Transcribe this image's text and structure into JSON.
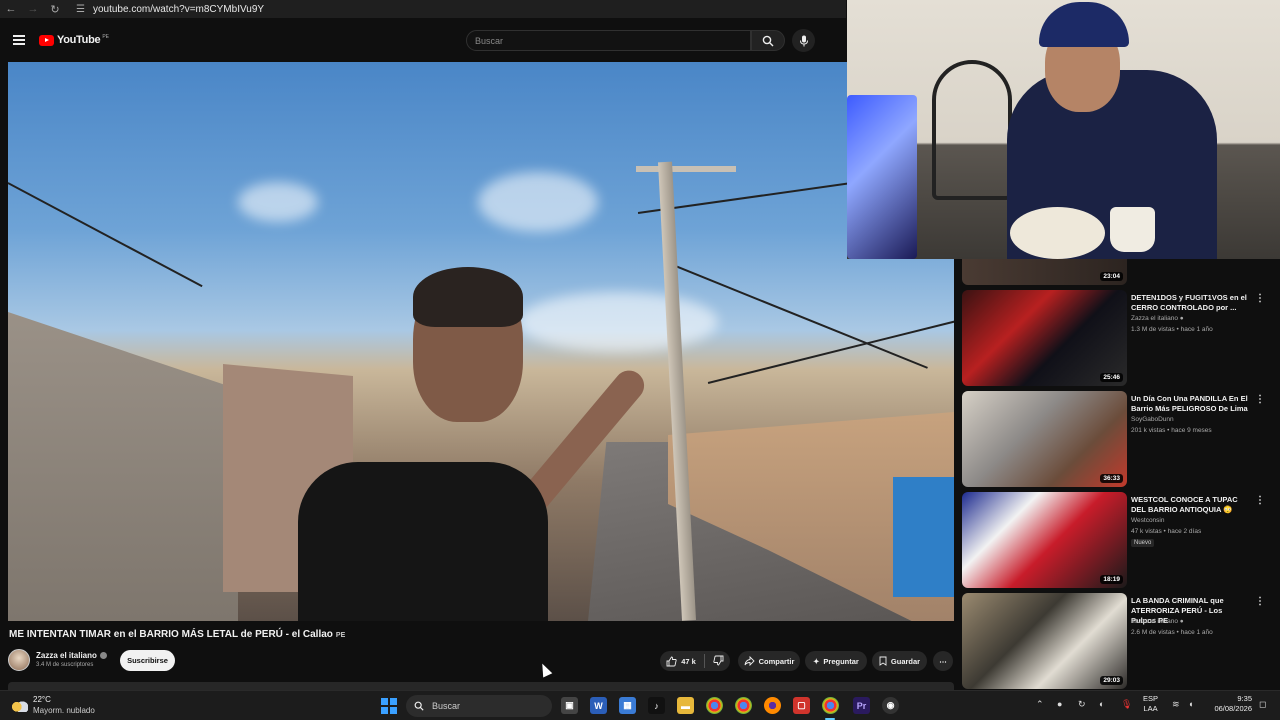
{
  "browser": {
    "url": "youtube.com/watch?v=m8CYMbIVu9Y",
    "icons": [
      "back-arrow-icon",
      "forward-arrow-icon",
      "reload-icon",
      "site-info-icon"
    ]
  },
  "header": {
    "logo_text": "YouTube",
    "country_code": "PE",
    "search_placeholder": "Buscar",
    "icons": [
      "hamburger-menu-icon",
      "search-icon",
      "microphone-icon"
    ]
  },
  "video": {
    "title": "ME INTENTAN TIMAR en el BARRIO MÁS LETAL de PERÚ - el Callao",
    "title_badge": "PE",
    "channel_name": "Zazza el italiano",
    "subscribers": "3.4 M de suscriptores",
    "subscribe_label": "Suscribirse",
    "likes": "47 k",
    "share_label": "Compartir",
    "ask_label": "Preguntar",
    "save_label": "Guardar"
  },
  "sidebar": {
    "top_duration": "23:04",
    "items": [
      {
        "title": "DETEN1DOS y FUGIT1VOS en el CERRO CONTROLADO por ...",
        "channel": "Zazza el italiano",
        "meta": "1.3 M de vistas • hace 1 año",
        "duration": "25:46",
        "badge": ""
      },
      {
        "title": "Un Día Con Una PANDILLA En El Barrio Más PELIGROSO De Lima",
        "channel": "SoyGaboDunn",
        "meta": "201 k vistas • hace 9 meses",
        "duration": "36:33",
        "badge": ""
      },
      {
        "title": "WESTCOL CONOCE A TUPAC DEL BARRIO ANTIOQUIA 😳",
        "channel": "Westconsin",
        "meta": "47 k vistas • hace 2 días",
        "duration": "18:19",
        "badge": "Nuevo"
      },
      {
        "title": "LA BANDA CRIMINAL que ATERRORIZA PERÚ - Los Pulpos PE",
        "channel": "Zazza el italiano",
        "meta": "2.6 M de vistas • hace 1 año",
        "duration": "29:03",
        "badge": ""
      }
    ]
  },
  "taskbar": {
    "weather_temp": "22°C",
    "weather_desc": "Mayorm. nublado",
    "search_label": "Buscar",
    "lang_line1": "ESP",
    "lang_line2": "LAA",
    "time": "9:35",
    "date": "06/08/2026"
  },
  "colors": {
    "brand_red": "#ff0000",
    "background": "#0f0f0f",
    "pill_bg": "#272727"
  }
}
